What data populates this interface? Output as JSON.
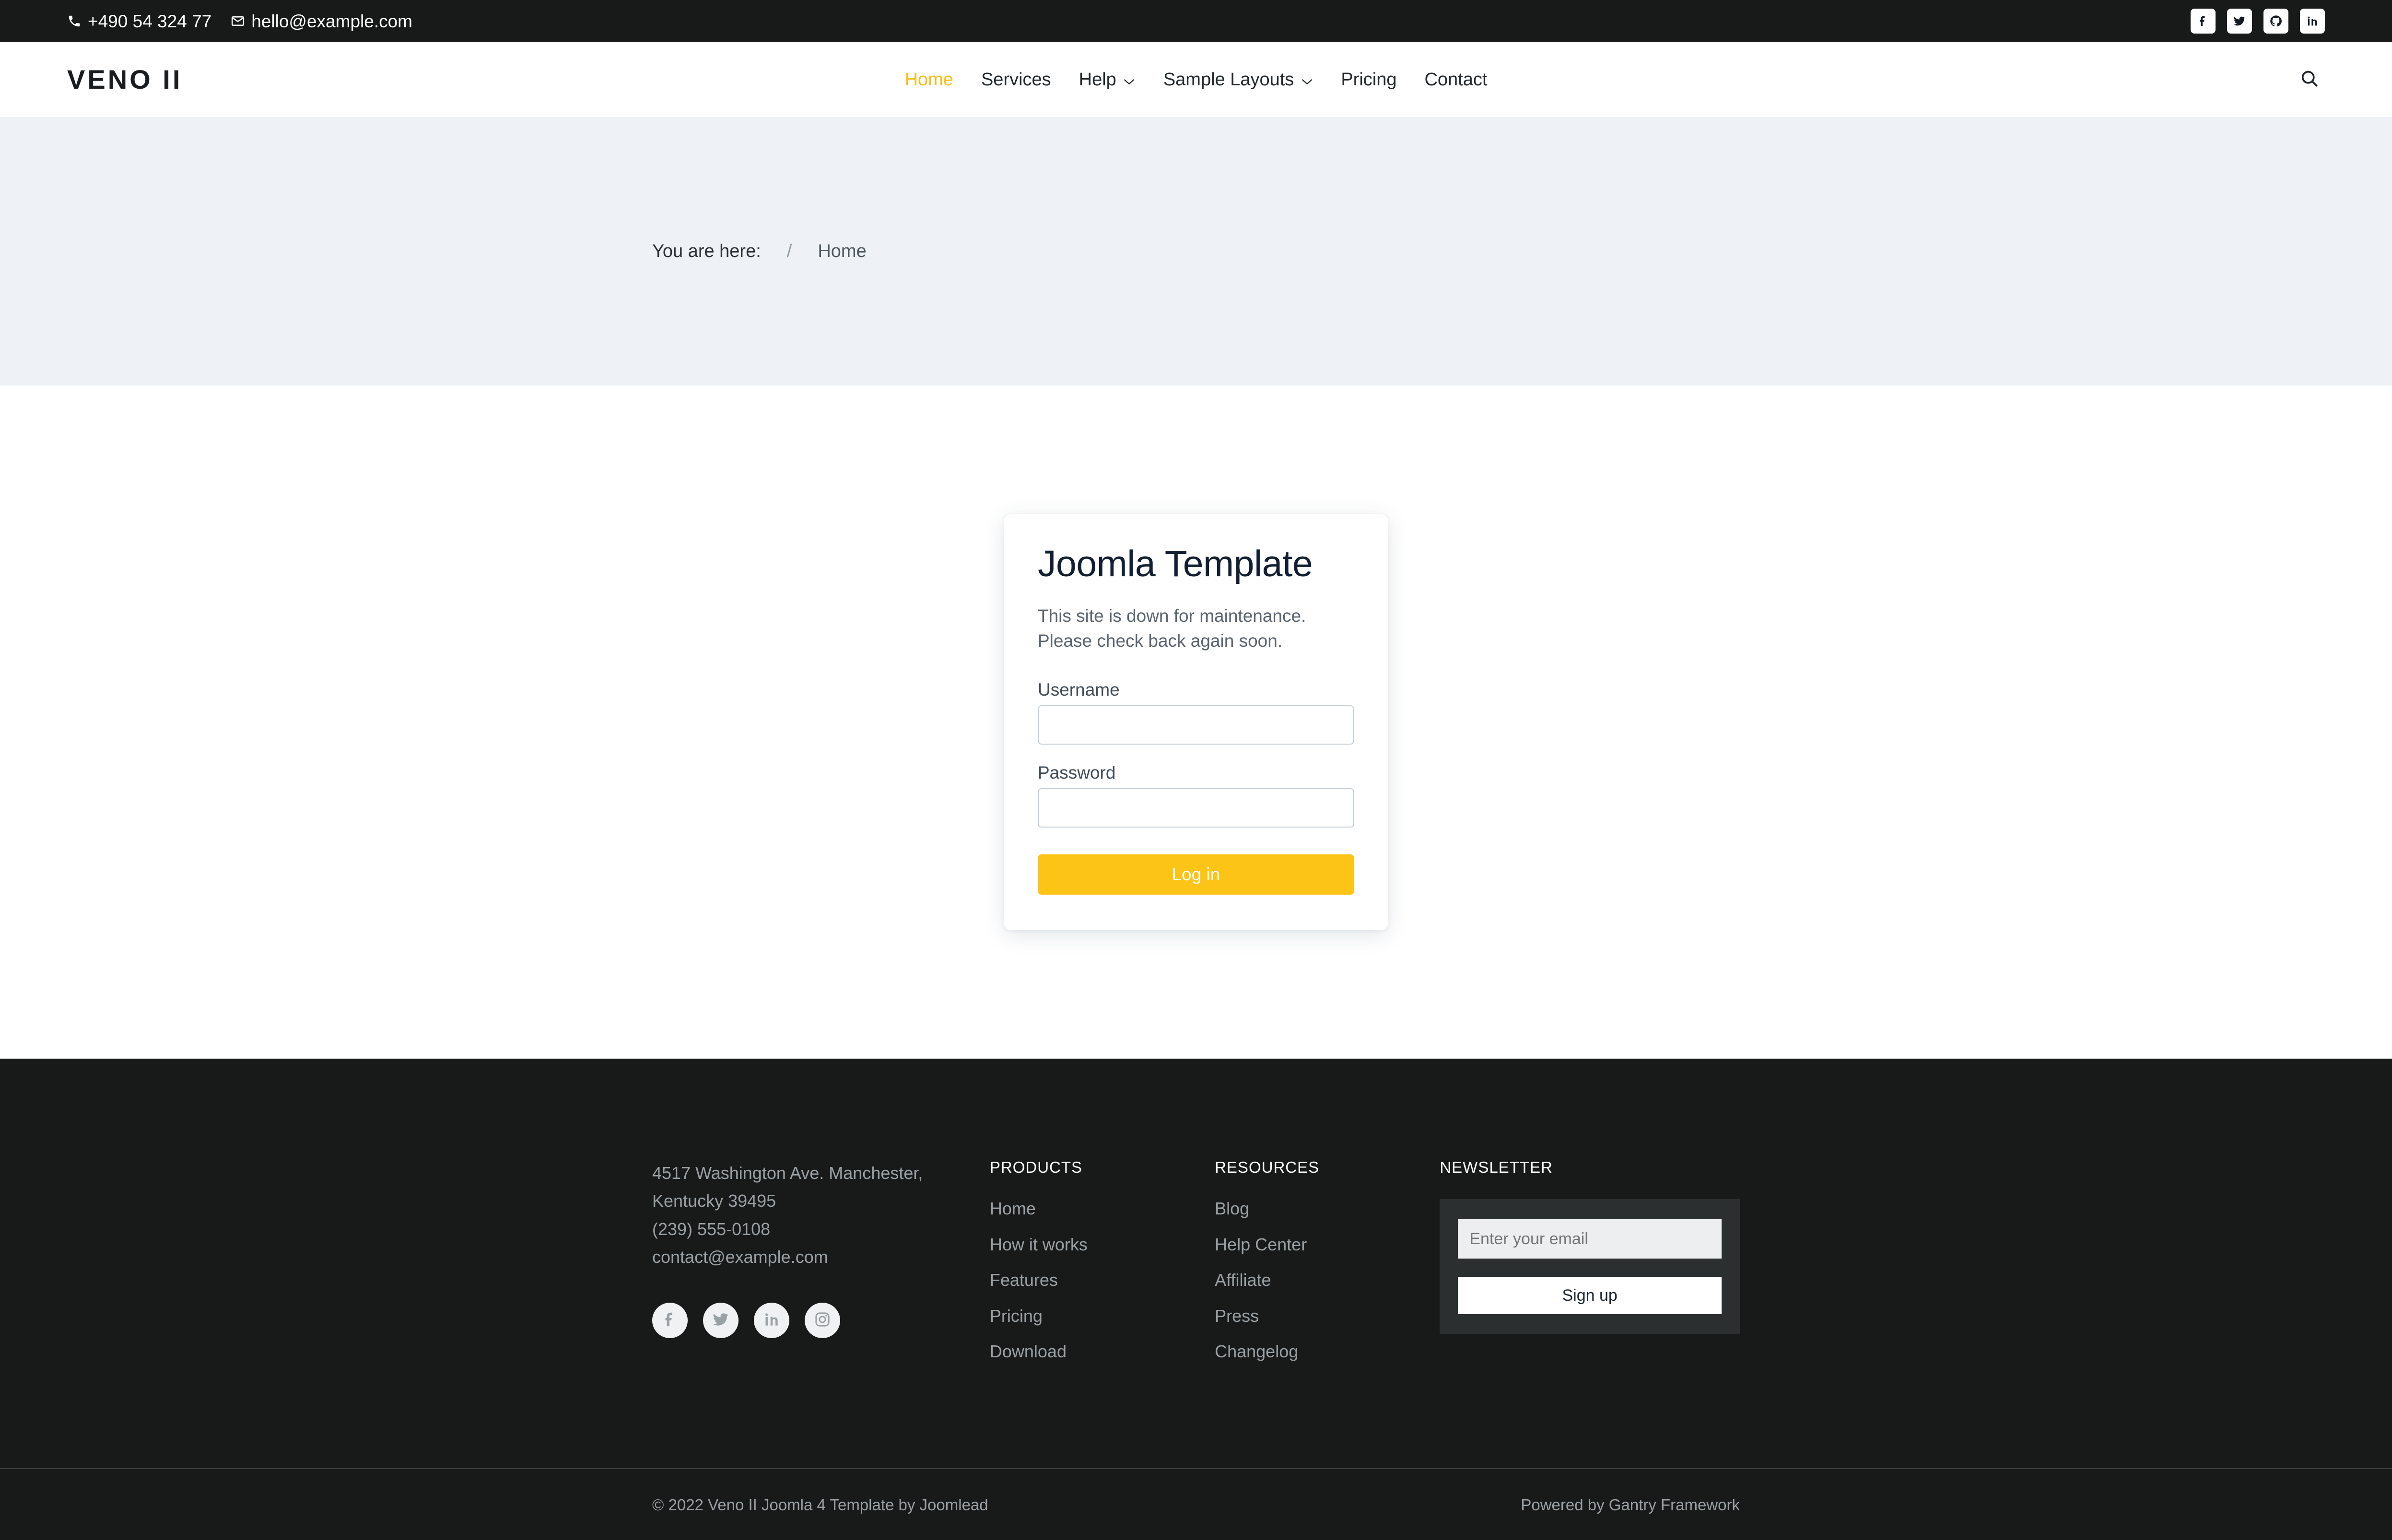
{
  "topbar": {
    "phone": "+490 54 324 77",
    "email": "hello@example.com",
    "phone_icon": "phone-icon",
    "email_icon": "envelope-icon",
    "socials": [
      {
        "name": "facebook-icon",
        "label": "Facebook"
      },
      {
        "name": "twitter-icon",
        "label": "Twitter"
      },
      {
        "name": "github-icon",
        "label": "GitHub"
      },
      {
        "name": "linkedin-icon",
        "label": "LinkedIn"
      }
    ]
  },
  "header": {
    "logo": "VENO II",
    "nav": [
      {
        "label": "Home",
        "active": true,
        "caret": ""
      },
      {
        "label": "Services",
        "active": false,
        "caret": ""
      },
      {
        "label": "Help",
        "active": false,
        "caret": "⌄"
      },
      {
        "label": "Sample Layouts",
        "active": false,
        "caret": "⌄"
      },
      {
        "label": "Pricing",
        "active": false,
        "caret": ""
      },
      {
        "label": "Contact",
        "active": false,
        "caret": ""
      }
    ],
    "search_icon": "search-icon"
  },
  "breadcrumb": {
    "prefix": "You are here:",
    "separator": "/",
    "current": "Home"
  },
  "login_card": {
    "title": "Joomla Template",
    "message_line1": "This site is down for maintenance.",
    "message_line2": "Please check back again soon.",
    "username_label": "Username",
    "username_value": "",
    "username_placeholder": "",
    "password_label": "Password",
    "password_value": "",
    "password_placeholder": "",
    "submit_label": "Log in"
  },
  "footer": {
    "address_line1": "4517 Washington Ave. Manchester,",
    "address_line2": "Kentucky 39495",
    "phone": "(239) 555-0108",
    "email": "contact@example.com",
    "socials": [
      {
        "name": "facebook-icon",
        "label": "Facebook"
      },
      {
        "name": "twitter-icon",
        "label": "Twitter"
      },
      {
        "name": "linkedin-icon",
        "label": "LinkedIn"
      },
      {
        "name": "instagram-icon",
        "label": "Instagram"
      }
    ],
    "products": {
      "heading": "PRODUCTS",
      "links": [
        "Home",
        "How it works",
        "Features",
        "Pricing",
        "Download"
      ]
    },
    "resources": {
      "heading": "RESOURCES",
      "links": [
        "Blog",
        "Help Center",
        "Affiliate",
        "Press",
        "Changelog"
      ]
    },
    "newsletter": {
      "heading": "NEWSLETTER",
      "email_value": "",
      "email_placeholder": "Enter your email",
      "signup_label": "Sign up"
    }
  },
  "copyright": {
    "left": "© 2022 Veno II Joomla 4 Template by Joomlead",
    "right": "Powered by Gantry Framework"
  },
  "colors": {
    "accent": "#fbbd18",
    "button": "#fbc417",
    "dark": "#181a1a",
    "band": "#eef2f6",
    "title": "#121f33"
  }
}
